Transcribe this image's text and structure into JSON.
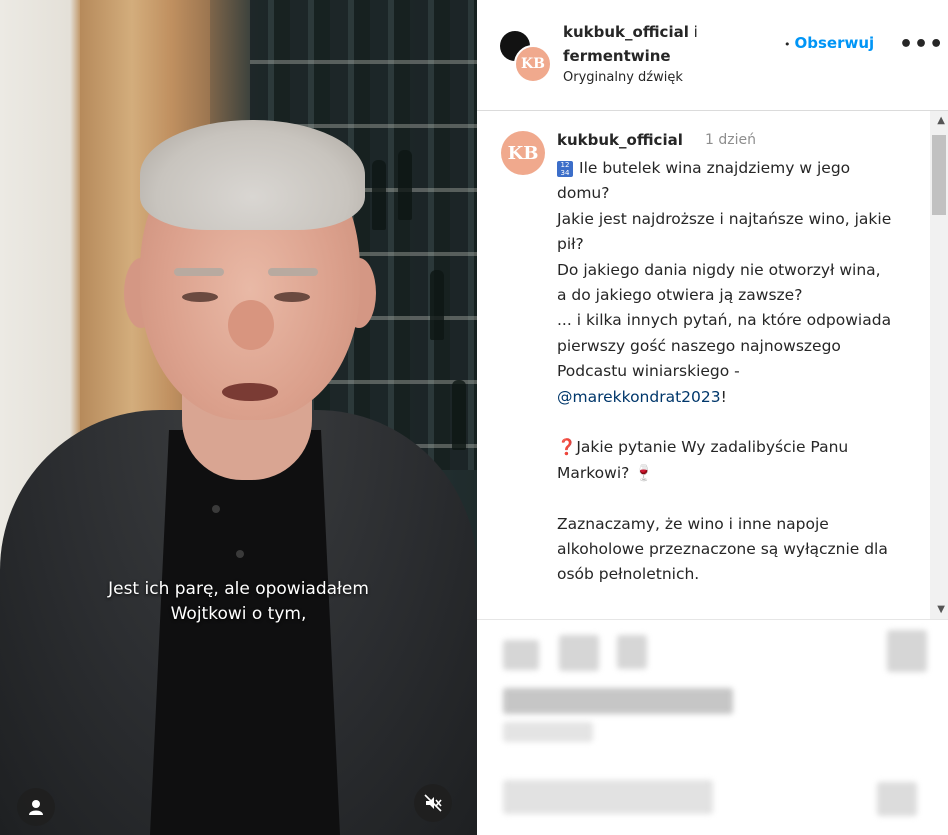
{
  "video": {
    "subtitle_line1": "Jest ich parę, ale opowiadałem",
    "subtitle_line2": "Wojtkowi o tym,"
  },
  "header": {
    "user_primary": "kukbuk_official",
    "connector": "i",
    "user_secondary": "fermentwine",
    "audio": "Oryginalny dźwięk",
    "separator": "•",
    "follow_label": "Obserwuj",
    "more_label": "•••",
    "avatar_initials": "KB"
  },
  "caption": {
    "avatar_initials": "KB",
    "username": "kukbuk_official",
    "time": "1 dzień",
    "line1": "Ile butelek wina znajdziemy w jego domu?",
    "line2": "Jakie jest najdroższe i najtańsze wino, jakie pił?",
    "line3": "Do jakiego dania nigdy nie otworzył wina, a do jakiego otwiera ją zawsze?",
    "line4": "... i kilka innych pytań, na które odpowiada pierwszy gość naszego najnowszego Podcastu winiarskiego -",
    "mention": "@marekkondrat2023",
    "mention_suffix": "!",
    "question_emoji": "❓",
    "question": "Jakie pytanie Wy zadalibyście Panu Markowi?",
    "wine_emoji": "🍷",
    "disclaimer": "Zaznaczamy, że wino i inne napoje alkoholowe przeznaczone są wyłącznie dla osób pełnoletnich."
  },
  "colors": {
    "follow": "#0095f6",
    "avatar": "#f0a98d",
    "mention": "#00376b"
  },
  "icons": [
    "user-icon",
    "muted-speaker-icon",
    "more-options-icon",
    "scroll-up-icon",
    "scroll-down-icon"
  ]
}
